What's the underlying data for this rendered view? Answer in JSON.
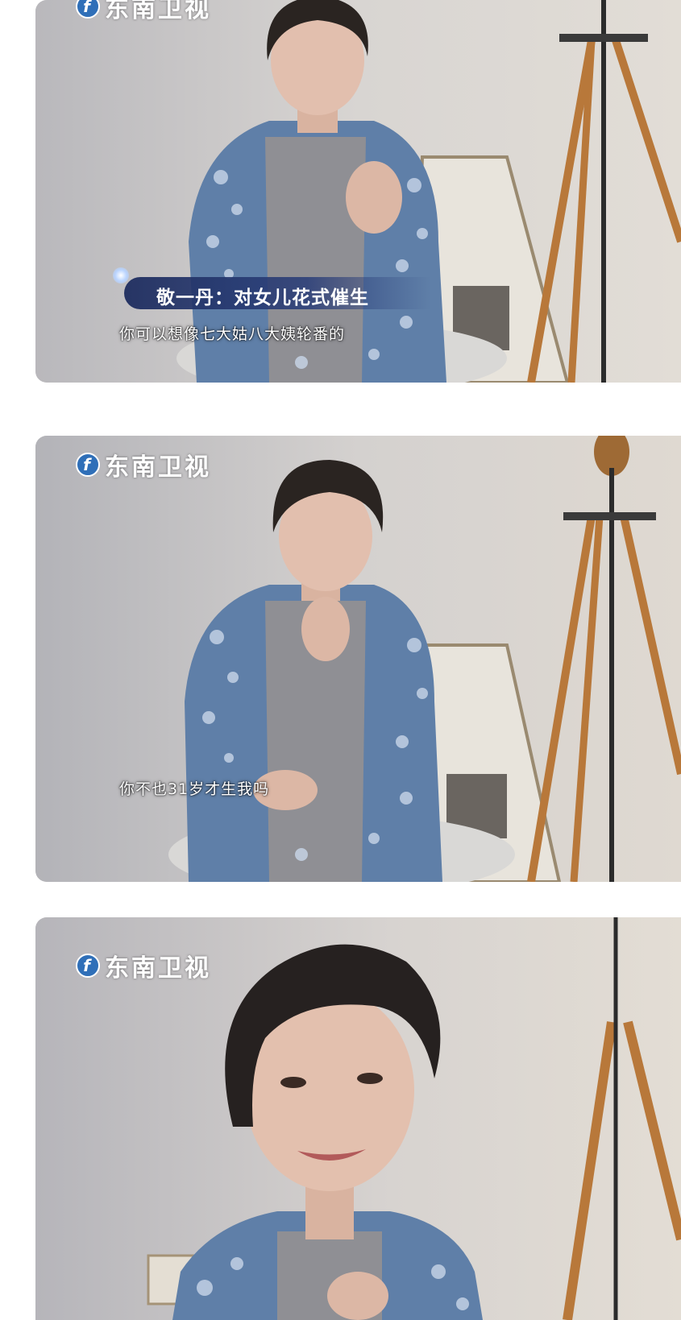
{
  "panels": [
    {
      "channel_logo": "东南卫视",
      "name_caption": "敬一丹：对女儿花式催生",
      "subtitle": "你可以想像七大姑八大姨轮番的"
    },
    {
      "channel_logo": "东南卫视",
      "subtitle": "你不也31岁才生我吗"
    },
    {
      "channel_logo": "东南卫视"
    }
  ]
}
